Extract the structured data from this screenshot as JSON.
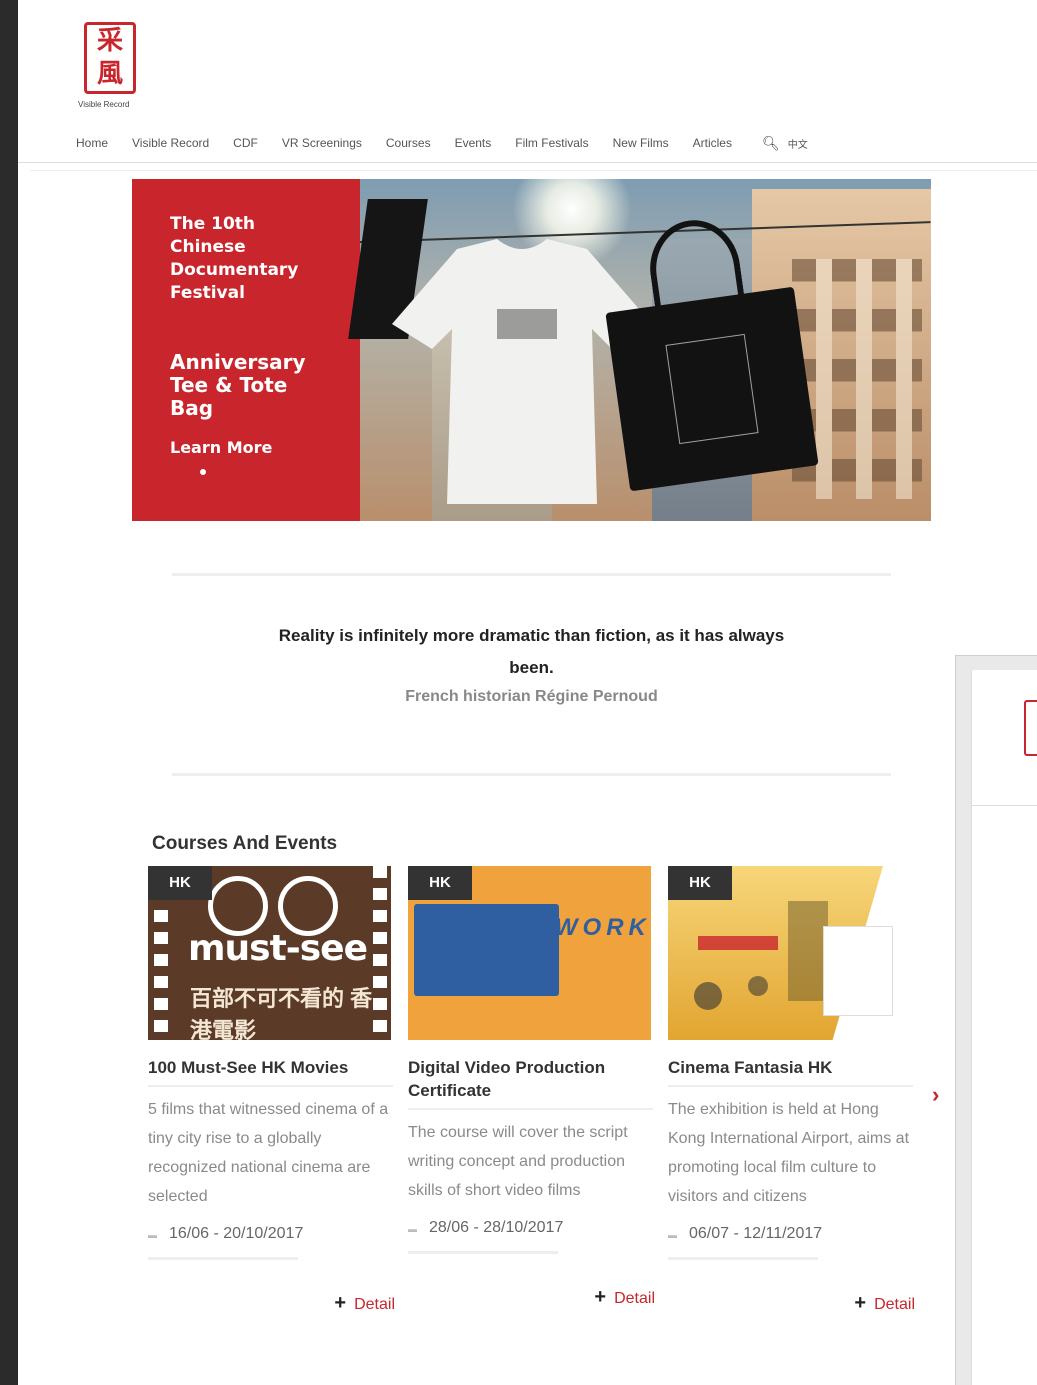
{
  "logo": {
    "seal_text": "采風",
    "caption": "Visible Record"
  },
  "nav": {
    "items": [
      "Home",
      "Visible Record",
      "CDF",
      "VR Screenings",
      "Courses",
      "Events",
      "Film Festivals",
      "New Films",
      "Articles"
    ],
    "search_icon": "search-icon",
    "language": "中文"
  },
  "hero": {
    "kicker": "The 10th Chinese Documentary Festival",
    "title": "Anniversary Tee & Tote Bag",
    "cta": "Learn More",
    "accent_color": "#c8262c"
  },
  "quote": {
    "text": "Reality is infinitely more dramatic than fiction, as it has always been.",
    "author": "French historian Régine Pernoud"
  },
  "courses": {
    "title": "Courses And Events",
    "cards": [
      {
        "tag": "HK",
        "title": "100 Must-See HK Movies",
        "description": "5 films that witnessed cinema of a tiny city rise to a globally recognized national cinema are selected",
        "date": "16/06 - 20/10/2017",
        "detail": "Detail",
        "image_text": "must-see",
        "image_cjk": "百部不可不看的 香港電影"
      },
      {
        "tag": "HK",
        "title": "Digital Video Production Certificate",
        "description": "The course will cover the script writing concept and production skills of short video films",
        "date": "28/06 - 28/10/2017",
        "detail": "Detail",
        "image_text": "FEVAWORKS"
      },
      {
        "tag": "HK",
        "title": "Cinema Fantasia HK",
        "description": "The exhibition is held at Hong Kong International Airport, aims at promoting local film culture to visitors and citizens",
        "date": "06/07 - 12/11/2017",
        "detail": "Detail"
      }
    ],
    "next_icon": "chevron-right-icon"
  }
}
